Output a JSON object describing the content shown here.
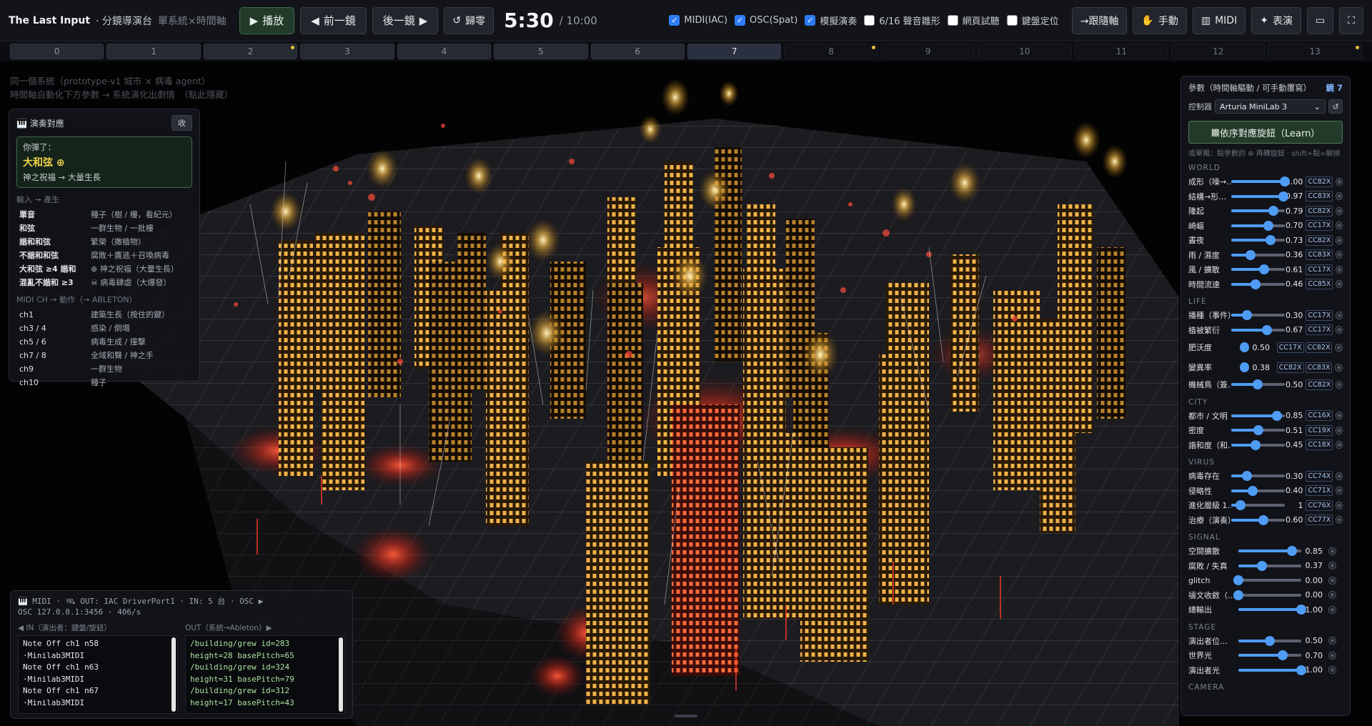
{
  "header": {
    "brand": "The Last Input",
    "subtitle": "· 分鏡導演台",
    "subtitle_mute": "單系統×時間軸",
    "play": "播放",
    "prev": "前一鏡",
    "next": "後一鏡",
    "reset": "歸零",
    "time_current": "5:30",
    "time_total": "/ 10:00",
    "checks": [
      {
        "label": "MIDI(IAC)",
        "checked": true
      },
      {
        "label": "OSC(Spat)",
        "checked": true
      },
      {
        "label": "模擬演奏",
        "checked": true
      },
      {
        "label": "6/16 聲音雛形",
        "checked": false
      },
      {
        "label": "網頁試聽",
        "checked": false
      },
      {
        "label": "鍵盤定位",
        "checked": false
      }
    ],
    "follow_axis": "→跟隨軸",
    "manual": "手動",
    "midi": "MIDI",
    "perform": "表演"
  },
  "shots": [
    "0",
    "1",
    "2",
    "3",
    "4",
    "5",
    "6",
    "7",
    "8",
    "9",
    "10",
    "11",
    "12",
    "13"
  ],
  "hint": {
    "line1": "同一個系統（prototype-v1 城市 × 病毒 agent）",
    "line2": "時間軸自動化下方參數 → 系統演化出劇情　（點此隱藏）"
  },
  "mapping": {
    "title": "演奏對應",
    "collapse": "收",
    "played_label": "你彈了：",
    "played_chord": "大和弦 ⊕",
    "played_result": "神之祝福 → 大量生長",
    "input_label": "輸入 → 產生",
    "inputs": [
      {
        "k": "單音",
        "v": "種子（樹 / 樓，看紀元）"
      },
      {
        "k": "和弦",
        "v": "一群生物 / 一批樓"
      },
      {
        "k": "諧和和弦",
        "v": "繁榮（撒植物）"
      },
      {
        "k": "不諧和和弦",
        "v": "腐敗＋鷹逃＋召喚病毒"
      },
      {
        "k": "大和弦 ≥4 諧和",
        "v": "⊕ 神之祝福（大量生長）"
      },
      {
        "k": "混亂不諧和 ≥3",
        "v": "☠ 病毒肆虐（大爆發）"
      }
    ],
    "ch_label": "MIDI CH → 動作（→ ABLETON）",
    "channels": [
      {
        "k": "ch1",
        "v": "建築生長（按住的鍵）"
      },
      {
        "k": "ch3 / 4",
        "v": "感染 / 倒塌"
      },
      {
        "k": "ch5 / 6",
        "v": "病毒生成 / 撞擊"
      },
      {
        "k": "ch7 / 8",
        "v": "全域和聲 / 神之手"
      },
      {
        "k": "ch9",
        "v": "一群生物"
      },
      {
        "k": "ch10",
        "v": "種子"
      }
    ]
  },
  "midilog": {
    "header1": "🎹 MIDI · 🛰 OUT: IAC DriverPort1 · IN: 5 台 · OSC ▶",
    "header2": "OSC    127.0.0.1:3456 · 406/s",
    "in_title": "◀ IN（演出者：鍵盤/旋鈕）",
    "out_title": "OUT（系統→Ableton）▶",
    "in_lines": [
      "Note Off ch1 n58",
      " ·Minilab3MIDI",
      "Note Off ch1 n63",
      " ·Minilab3MIDI",
      "Note Off ch1 n67",
      " ·Minilab3MIDI"
    ],
    "out_lines": [
      "/building/grew id=283",
      "height=28 basePitch=65",
      "/building/grew id=324",
      "height=31 basePitch=79",
      "/building/grew id=312",
      "height=17 basePitch=43"
    ]
  },
  "params": {
    "title": "參數（時間軸驅動 / 可手動覆寫）",
    "shot": "鏡 7",
    "controller_label": "控制器",
    "controller": "Arturia MiniLab 3",
    "learn": "依序對應旋鈕（Learn）",
    "learn_hint": "或單獨：點參數的 ⊕ 再轉旋鈕 · shift+點=解綁",
    "groups": [
      {
        "title": "WORLD",
        "items": [
          {
            "label": "成形（噪→…",
            "value": 1.0,
            "display": "1.00",
            "cc": [
              "CC82X"
            ]
          },
          {
            "label": "結構→形…",
            "value": 0.97,
            "display": "0.97",
            "cc": [
              "CC83X"
            ]
          },
          {
            "label": "隆起",
            "value": 0.79,
            "display": "0.79",
            "cc": [
              "CC82X"
            ]
          },
          {
            "label": "崎嶇",
            "value": 0.7,
            "display": "0.70",
            "cc": [
              "CC17X"
            ]
          },
          {
            "label": "晝夜",
            "value": 0.73,
            "display": "0.73",
            "cc": [
              "CC82X"
            ]
          },
          {
            "label": "雨 / 濕度",
            "value": 0.36,
            "display": "0.36",
            "cc": [
              "CC83X"
            ]
          },
          {
            "label": "風 / 擴散",
            "value": 0.61,
            "display": "0.61",
            "cc": [
              "CC17X"
            ]
          },
          {
            "label": "時間流速",
            "value": 0.46,
            "display": "0.46",
            "cc": [
              "CC85X"
            ]
          }
        ]
      },
      {
        "title": "LIFE",
        "items": [
          {
            "label": "播種（事件）",
            "value": 0.3,
            "display": "0.30",
            "cc": [
              "CC17X"
            ]
          },
          {
            "label": "植被繁衍",
            "value": 0.67,
            "display": "0.67",
            "cc": [
              "CC17X"
            ]
          },
          {
            "label": "肥沃度",
            "value": 0.5,
            "display": "0.50",
            "cc": [
              "CC17X",
              "CC82X"
            ],
            "compact": true
          },
          {
            "label": "變異率",
            "value": 0.38,
            "display": "0.38",
            "cc": [
              "CC82X",
              "CC83X"
            ],
            "compact": true
          },
          {
            "label": "機械鳥（簽…",
            "value": 0.5,
            "display": "0.50",
            "cc": [
              "CC82X"
            ]
          }
        ]
      },
      {
        "title": "CITY",
        "items": [
          {
            "label": "都市 / 文明",
            "value": 0.85,
            "display": "0.85",
            "cc": [
              "CC16X"
            ]
          },
          {
            "label": "密度",
            "value": 0.51,
            "display": "0.51",
            "cc": [
              "CC19X"
            ]
          },
          {
            "label": "諧和度（和…",
            "value": 0.45,
            "display": "0.45",
            "cc": [
              "CC18X"
            ]
          }
        ]
      },
      {
        "title": "VIRUS",
        "items": [
          {
            "label": "病毒存在",
            "value": 0.3,
            "display": "0.30",
            "cc": [
              "CC74X"
            ]
          },
          {
            "label": "侵略性",
            "value": 0.4,
            "display": "0.40",
            "cc": [
              "CC71X"
            ]
          },
          {
            "label": "進化層級 1…",
            "value": 0.17,
            "display": "1",
            "cc": [
              "CC76X"
            ]
          },
          {
            "label": "治療（演奏）",
            "value": 0.6,
            "display": "0.60",
            "cc": [
              "CC77X"
            ]
          }
        ]
      },
      {
        "title": "SIGNAL",
        "items": [
          {
            "label": "空間擴散",
            "value": 0.85,
            "display": "0.85",
            "cc": []
          },
          {
            "label": "腐敗 / 失真",
            "value": 0.37,
            "display": "0.37",
            "cc": []
          },
          {
            "label": "glitch",
            "value": 0.0,
            "display": "0.00",
            "cc": []
          },
          {
            "label": "禱文收斂（…",
            "value": 0.0,
            "display": "0.00",
            "cc": []
          },
          {
            "label": "總輸出",
            "value": 1.0,
            "display": "1.00",
            "cc": []
          }
        ]
      },
      {
        "title": "STAGE",
        "items": [
          {
            "label": "演出者位…",
            "value": 0.5,
            "display": "0.50",
            "cc": []
          },
          {
            "label": "世界光",
            "value": 0.7,
            "display": "0.70",
            "cc": []
          },
          {
            "label": "演出者光",
            "value": 1.0,
            "display": "1.00",
            "cc": []
          }
        ]
      },
      {
        "title": "CAMERA",
        "items": []
      }
    ]
  },
  "colors": {
    "accent": "#4f9cf5",
    "gold": "#f2c060",
    "virus": "#e0382a",
    "play": "#233a2a"
  }
}
